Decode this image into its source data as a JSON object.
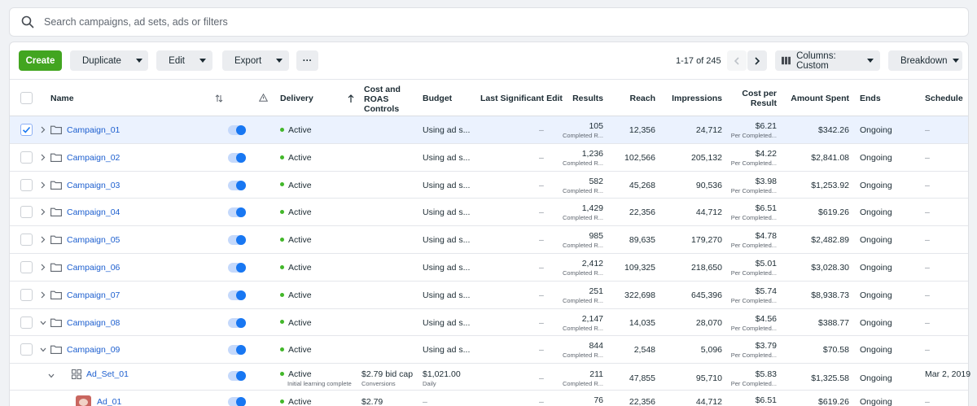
{
  "search": {
    "placeholder": "Search campaigns, ad sets, ads or filters"
  },
  "toolbar": {
    "create_label": "Create",
    "duplicate_label": "Duplicate",
    "edit_label": "Edit",
    "export_label": "Export",
    "more_label": "···",
    "pager_text": "1-17 of 245",
    "columns_label": "Columns: Custom",
    "breakdown_label": "Breakdown"
  },
  "headers": {
    "name": "Name",
    "delivery": "Delivery",
    "cost_roas_1": "Cost and",
    "cost_roas_2": "ROAS",
    "cost_roas_3": "Controls",
    "budget": "Budget",
    "last_edit": "Last Significant Edit",
    "results": "Results",
    "reach": "Reach",
    "impressions": "Impressions",
    "cpr_1": "Cost per",
    "cpr_2": "Result",
    "amount_spent": "Amount Spent",
    "ends": "Ends",
    "schedule": "Schedule"
  },
  "rows": [
    {
      "name": "Campaign_01",
      "delivery": "Active",
      "budget": "Using ad s...",
      "last_edit": "–",
      "results": "105",
      "results_sub": "Completed R...",
      "reach": "12,356",
      "impressions": "24,712",
      "cpr": "$6.21",
      "cpr_sub": "Per Completed...",
      "spent": "$342.26",
      "ends": "Ongoing",
      "schedule": "–"
    },
    {
      "name": "Campaign_02",
      "delivery": "Active",
      "budget": "Using ad s...",
      "last_edit": "–",
      "results": "1,236",
      "results_sub": "Completed R...",
      "reach": "102,566",
      "impressions": "205,132",
      "cpr": "$4.22",
      "cpr_sub": "Per Completed...",
      "spent": "$2,841.08",
      "ends": "Ongoing",
      "schedule": "–"
    },
    {
      "name": "Campaign_03",
      "delivery": "Active",
      "budget": "Using ad s...",
      "last_edit": "–",
      "results": "582",
      "results_sub": "Completed R...",
      "reach": "45,268",
      "impressions": "90,536",
      "cpr": "$3.98",
      "cpr_sub": "Per Completed...",
      "spent": "$1,253.92",
      "ends": "Ongoing",
      "schedule": "–"
    },
    {
      "name": "Campaign_04",
      "delivery": "Active",
      "budget": "Using ad s...",
      "last_edit": "–",
      "results": "1,429",
      "results_sub": "Completed R...",
      "reach": "22,356",
      "impressions": "44,712",
      "cpr": "$6.51",
      "cpr_sub": "Per Completed...",
      "spent": "$619.26",
      "ends": "Ongoing",
      "schedule": "–"
    },
    {
      "name": "Campaign_05",
      "delivery": "Active",
      "budget": "Using ad s...",
      "last_edit": "–",
      "results": "985",
      "results_sub": "Completed R...",
      "reach": "89,635",
      "impressions": "179,270",
      "cpr": "$4.78",
      "cpr_sub": "Per Completed...",
      "spent": "$2,482.89",
      "ends": "Ongoing",
      "schedule": "–"
    },
    {
      "name": "Campaign_06",
      "delivery": "Active",
      "budget": "Using ad s...",
      "last_edit": "–",
      "results": "2,412",
      "results_sub": "Completed R...",
      "reach": "109,325",
      "impressions": "218,650",
      "cpr": "$5.01",
      "cpr_sub": "Per Completed...",
      "spent": "$3,028.30",
      "ends": "Ongoing",
      "schedule": "–"
    },
    {
      "name": "Campaign_07",
      "delivery": "Active",
      "budget": "Using ad s...",
      "last_edit": "–",
      "results": "251",
      "results_sub": "Completed R...",
      "reach": "322,698",
      "impressions": "645,396",
      "cpr": "$5.74",
      "cpr_sub": "Per Completed...",
      "spent": "$8,938.73",
      "ends": "Ongoing",
      "schedule": "–"
    },
    {
      "name": "Campaign_08",
      "delivery": "Active",
      "budget": "Using ad s...",
      "last_edit": "–",
      "results": "2,147",
      "results_sub": "Completed R...",
      "reach": "14,035",
      "impressions": "28,070",
      "cpr": "$4.56",
      "cpr_sub": "Per Completed...",
      "spent": "$388.77",
      "ends": "Ongoing",
      "schedule": "–"
    },
    {
      "name": "Campaign_09",
      "delivery": "Active",
      "budget": "Using ad s...",
      "last_edit": "–",
      "results": "844",
      "results_sub": "Completed R...",
      "reach": "2,548",
      "impressions": "5,096",
      "cpr": "$3.79",
      "cpr_sub": "Per Completed...",
      "spent": "$70.58",
      "ends": "Ongoing",
      "schedule": "–"
    }
  ],
  "adset": {
    "name": "Ad_Set_01",
    "delivery": "Active",
    "delivery_sub": "Initial learning complete",
    "bid": "$2.79 bid cap",
    "bid_sub": "Conversions",
    "budget": "$1,021.00",
    "budget_sub": "Daily",
    "last_edit": "–",
    "results": "211",
    "results_sub": "Completed R...",
    "reach": "47,855",
    "impressions": "95,710",
    "cpr": "$5.83",
    "cpr_sub": "Per Completed...",
    "spent": "$1,325.58",
    "ends": "Ongoing",
    "schedule": "Mar 2, 2019"
  },
  "ad": {
    "name": "Ad_01",
    "delivery": "Active",
    "bid": "$2.79",
    "budget": "–",
    "last_edit": "–",
    "results": "76",
    "reach": "22,356",
    "impressions": "44,712",
    "cpr": "$6.51",
    "spent": "$619.26",
    "ends": "Ongoing",
    "schedule": "–"
  },
  "colors": {
    "accent": "#1877f2",
    "create": "#42a520",
    "active_dot": "#42b72a",
    "link": "#1d5fcf"
  }
}
